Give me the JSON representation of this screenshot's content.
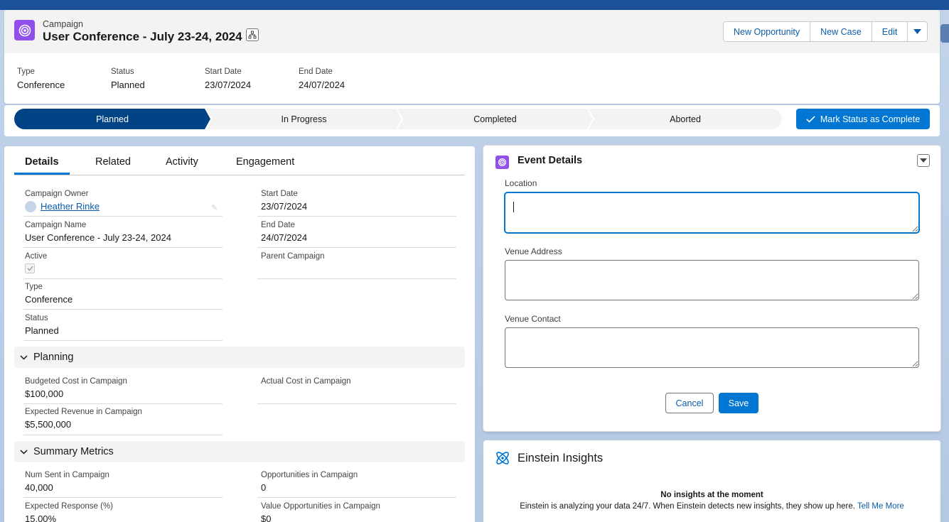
{
  "header": {
    "object_label": "Campaign",
    "title": "User Conference - July 23-24, 2024",
    "buttons": {
      "new_opportunity": "New Opportunity",
      "new_case": "New Case",
      "edit": "Edit"
    },
    "fields": [
      {
        "label": "Type",
        "value": "Conference"
      },
      {
        "label": "Status",
        "value": "Planned"
      },
      {
        "label": "Start Date",
        "value": "23/07/2024"
      },
      {
        "label": "End Date",
        "value": "24/07/2024"
      }
    ]
  },
  "path": {
    "stages": [
      "Planned",
      "In Progress",
      "Completed",
      "Aborted"
    ],
    "active_index": 0,
    "mark_button": "Mark Status as Complete"
  },
  "tabs": [
    "Details",
    "Related",
    "Activity",
    "Engagement"
  ],
  "details": {
    "campaign_owner": {
      "label": "Campaign Owner",
      "value": "Heather Rinke"
    },
    "start_date": {
      "label": "Start Date",
      "value": "23/07/2024"
    },
    "campaign_name": {
      "label": "Campaign Name",
      "value": "User Conference - July 23-24, 2024"
    },
    "end_date": {
      "label": "End Date",
      "value": "24/07/2024"
    },
    "active": {
      "label": "Active",
      "checked": true
    },
    "parent_campaign": {
      "label": "Parent Campaign",
      "value": ""
    },
    "type": {
      "label": "Type",
      "value": "Conference"
    },
    "status": {
      "label": "Status",
      "value": "Planned"
    }
  },
  "planning": {
    "title": "Planning",
    "budgeted_cost": {
      "label": "Budgeted Cost in Campaign",
      "value": "$100,000"
    },
    "actual_cost": {
      "label": "Actual Cost in Campaign",
      "value": ""
    },
    "expected_revenue": {
      "label": "Expected Revenue in Campaign",
      "value": "$5,500,000"
    }
  },
  "summary": {
    "title": "Summary Metrics",
    "num_sent": {
      "label": "Num Sent in Campaign",
      "value": "40,000"
    },
    "opportunities": {
      "label": "Opportunities in Campaign",
      "value": "0"
    },
    "expected_response": {
      "label": "Expected Response (%)",
      "value": "15.00%"
    },
    "value_opportunities": {
      "label": "Value Opportunities in Campaign",
      "value": "$0"
    }
  },
  "event_details": {
    "title": "Event Details",
    "location": {
      "label": "Location",
      "value": ""
    },
    "venue_address": {
      "label": "Venue Address",
      "value": ""
    },
    "venue_contact": {
      "label": "Venue Contact",
      "value": ""
    },
    "cancel": "Cancel",
    "save": "Save"
  },
  "einstein": {
    "title": "Einstein Insights",
    "none": "No insights at the moment",
    "desc": "Einstein is analyzing your data 24/7. When Einstein detects new insights, they show up here.",
    "link": "Tell Me More"
  },
  "colors": {
    "brand": "#0176d3",
    "active_stage": "#014486",
    "campaign_icon": "#9050e9"
  },
  "icons": [
    "campaign-icon",
    "hierarchy-icon",
    "chevron-down-icon",
    "check-icon",
    "pencil-icon",
    "einstein-icon"
  ]
}
